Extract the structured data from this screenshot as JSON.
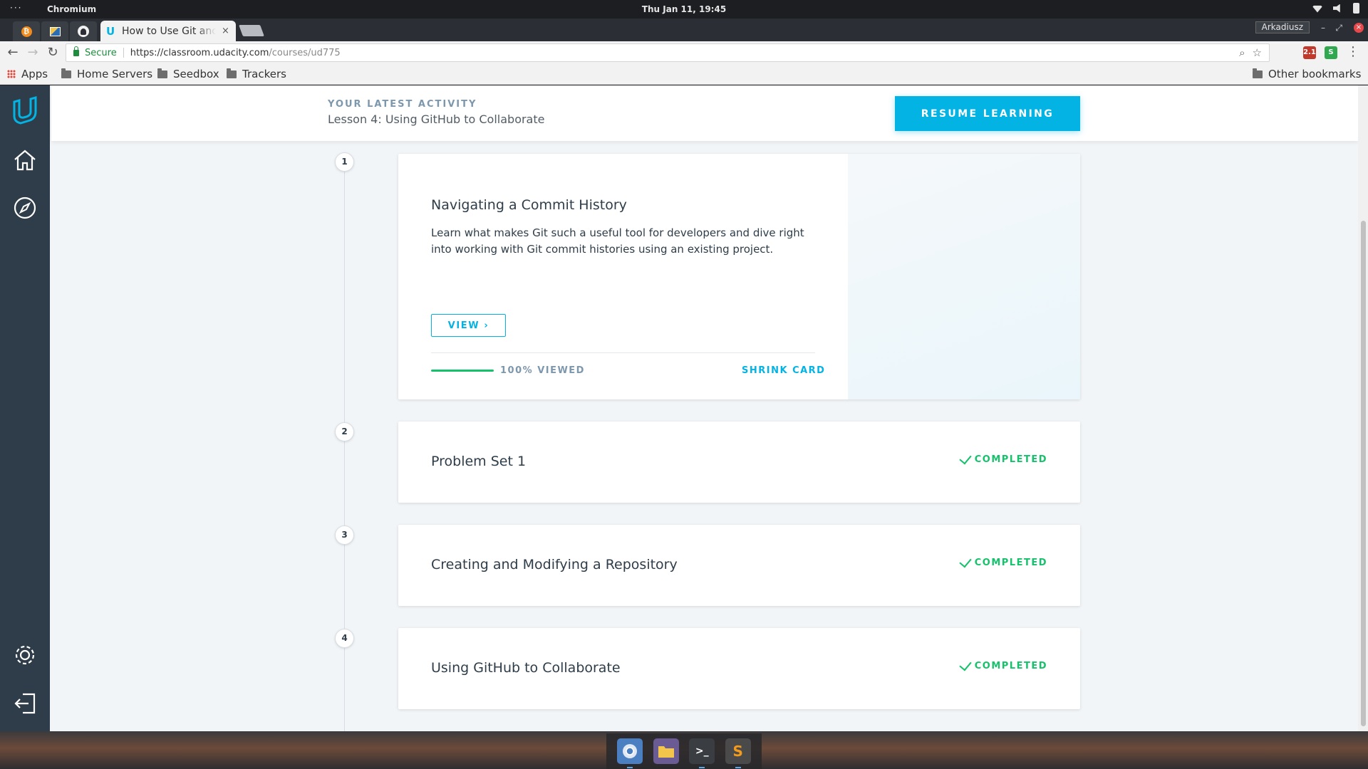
{
  "os": {
    "menu_dots": "···",
    "app_name": "Chromium",
    "clock": "Thu Jan 11, 19:45"
  },
  "browser": {
    "tab_title": "How to Use Git and GitHub",
    "tab_close": "×",
    "profile": "Arkadiusz",
    "secure_label": "Secure",
    "url_host": "https://classroom.udacity.com",
    "url_path": "/courses/ud775",
    "ext_badge": "2.1",
    "bookmarks": [
      "Apps",
      "Home Servers",
      "Seedbox",
      "Trackers"
    ],
    "other_bookmarks": "Other bookmarks"
  },
  "activity": {
    "label": "YOUR LATEST ACTIVITY",
    "lesson": "Lesson 4: Using GitHub to Collaborate",
    "resume_label": "RESUME LEARNING"
  },
  "lessons": [
    {
      "number": "1",
      "title": "Navigating a Commit History",
      "description": "Learn what makes Git such a useful tool for developers and dive right into working with Git commit histories using an existing project.",
      "view_label": "VIEW",
      "view_chevron": "›",
      "progress_fraction": 1.0,
      "progress_label": "100% VIEWED",
      "shrink_label": "SHRINK CARD"
    },
    {
      "number": "2",
      "title": "Problem Set 1",
      "status": "COMPLETED"
    },
    {
      "number": "3",
      "title": "Creating and Modifying a Repository",
      "status": "COMPLETED"
    },
    {
      "number": "4",
      "title": "Using GitHub to Collaborate",
      "status": "COMPLETED"
    }
  ],
  "dock": {
    "terminal_glyph": ">_",
    "sublime_glyph": "S"
  },
  "colors": {
    "accent": "#02b3e4",
    "success": "#15c26b",
    "sidebar": "#2e3d49"
  }
}
